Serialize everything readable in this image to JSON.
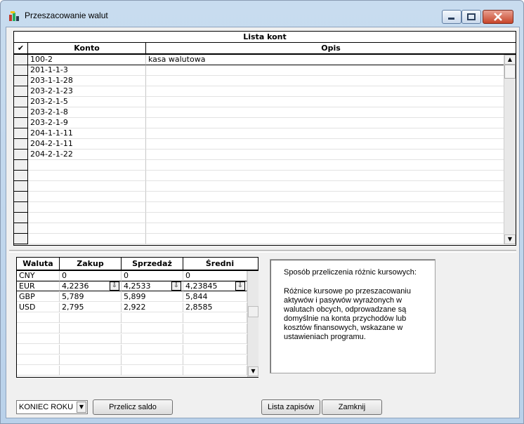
{
  "window": {
    "title": "Przeszacowanie walut"
  },
  "accounts": {
    "caption": "Lista kont",
    "check_header": "✔",
    "col_konto": "Konto",
    "col_opis": "Opis",
    "rows": [
      {
        "konto": "100-2",
        "opis": "kasa walutowa"
      },
      {
        "konto": "201-1-1-3",
        "opis": ""
      },
      {
        "konto": "203-1-1-28",
        "opis": ""
      },
      {
        "konto": "203-2-1-23",
        "opis": ""
      },
      {
        "konto": "203-2-1-5",
        "opis": ""
      },
      {
        "konto": "203-2-1-8",
        "opis": ""
      },
      {
        "konto": "203-2-1-9",
        "opis": ""
      },
      {
        "konto": "204-1-1-11",
        "opis": ""
      },
      {
        "konto": "204-2-1-11",
        "opis": ""
      },
      {
        "konto": "204-2-1-22",
        "opis": ""
      }
    ]
  },
  "currencies": {
    "col_waluta": "Waluta",
    "col_zakup": "Zakup",
    "col_sprzedaz": "Sprzedaż",
    "col_sredni": "Średni",
    "rows": [
      {
        "waluta": "CNY",
        "zakup": "0",
        "sprzedaz": "0",
        "sredni": "0"
      },
      {
        "waluta": "EUR",
        "zakup": "4,2236",
        "sprzedaz": "4,2533",
        "sredni": "4,23845"
      },
      {
        "waluta": "GBP",
        "zakup": "5,789",
        "sprzedaz": "5,899",
        "sredni": "5,844"
      },
      {
        "waluta": "USD",
        "zakup": "2,795",
        "sprzedaz": "2,922",
        "sredni": "2,8585"
      }
    ]
  },
  "info": {
    "line1": "Sposób przeliczenia różnic kursowych:",
    "line2": "Różnice kursowe po przeszacowaniu aktywów i pasywów wyrażonych w walutach obcych, odprowadzane są domyślnie na konta przychodów lub kosztów finansowych, wskazane w ustawieniach programu."
  },
  "controls": {
    "period_value": "KONIEC ROKU",
    "recalc_label": "Przelicz saldo",
    "list_label": "Lista zapisów",
    "close_label": "Zamknij"
  }
}
